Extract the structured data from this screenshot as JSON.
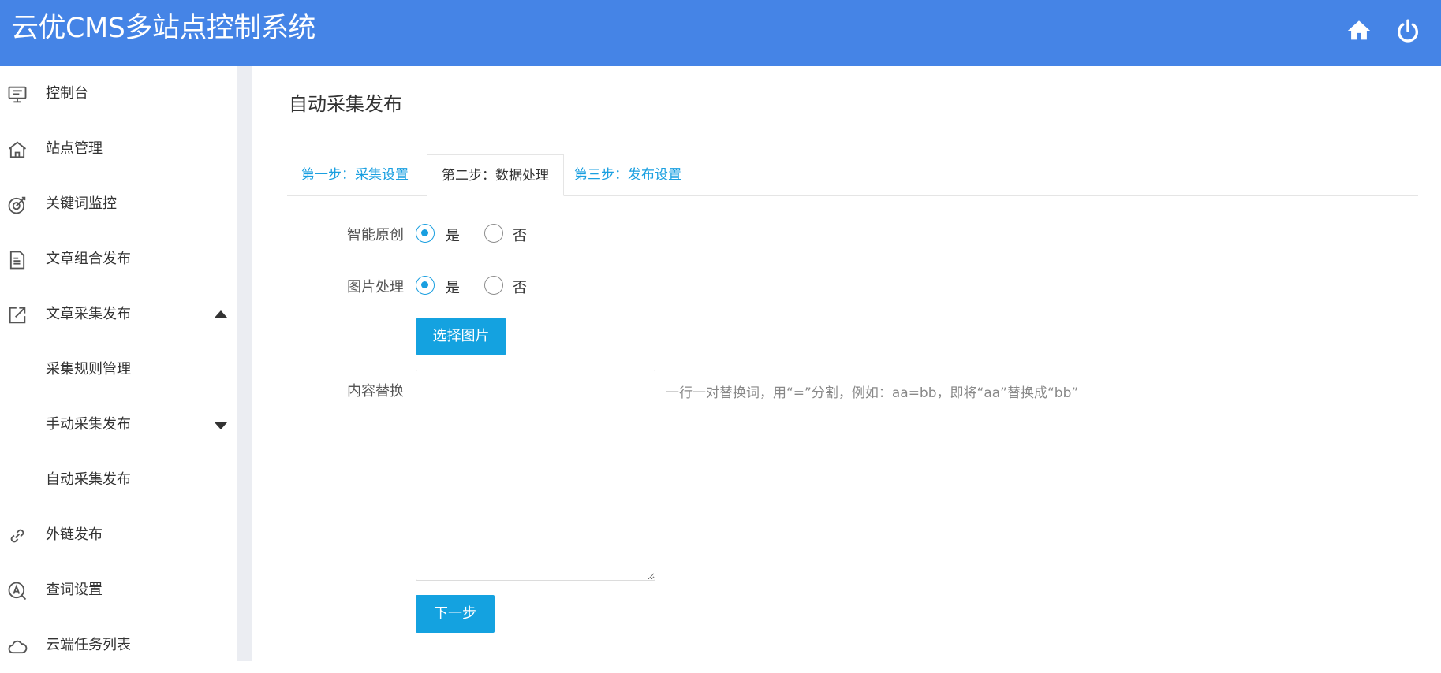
{
  "header": {
    "title": "云优CMS多站点控制系统",
    "home_icon": "home-icon",
    "power_icon": "power-icon",
    "background": "#4584e6"
  },
  "sidebar": {
    "items": [
      {
        "label": "控制台",
        "icon": "monitor-icon"
      },
      {
        "label": "站点管理",
        "icon": "home-outline-icon"
      },
      {
        "label": "关键词监控",
        "icon": "target-icon"
      },
      {
        "label": "文章组合发布",
        "icon": "document-icon"
      },
      {
        "label": "文章采集发布",
        "icon": "external-link-icon",
        "expanded": true
      },
      {
        "label": "采集规则管理"
      },
      {
        "label": "手动采集发布",
        "collapsed": true
      },
      {
        "label": "自动采集发布"
      },
      {
        "label": "外链发布",
        "icon": "link-icon"
      },
      {
        "label": "查词设置",
        "icon": "search-a-icon"
      },
      {
        "label": "云端任务列表",
        "icon": "cloud-icon"
      }
    ]
  },
  "main": {
    "page_title": "自动采集发布",
    "tabs": [
      {
        "label": "第一步：采集设置",
        "active": false
      },
      {
        "label": "第二步：数据处理",
        "active": true
      },
      {
        "label": "第三步：发布设置",
        "active": false
      }
    ],
    "form": {
      "smart_original": {
        "label": "智能原创",
        "options": [
          "是",
          "否"
        ],
        "selected": "是"
      },
      "image_processing": {
        "label": "图片处理",
        "options": [
          "是",
          "否"
        ],
        "selected": "是"
      },
      "select_image_button": "选择图片",
      "content_replace": {
        "label": "内容替换",
        "value": "",
        "hint": "一行一对替换词，用“=”分割，例如：aa=bb，即将“aa”替换成“bb”"
      },
      "next_button": "下一步"
    }
  },
  "colors": {
    "accent": "#1a9fe0",
    "button": "#14a2e0"
  }
}
